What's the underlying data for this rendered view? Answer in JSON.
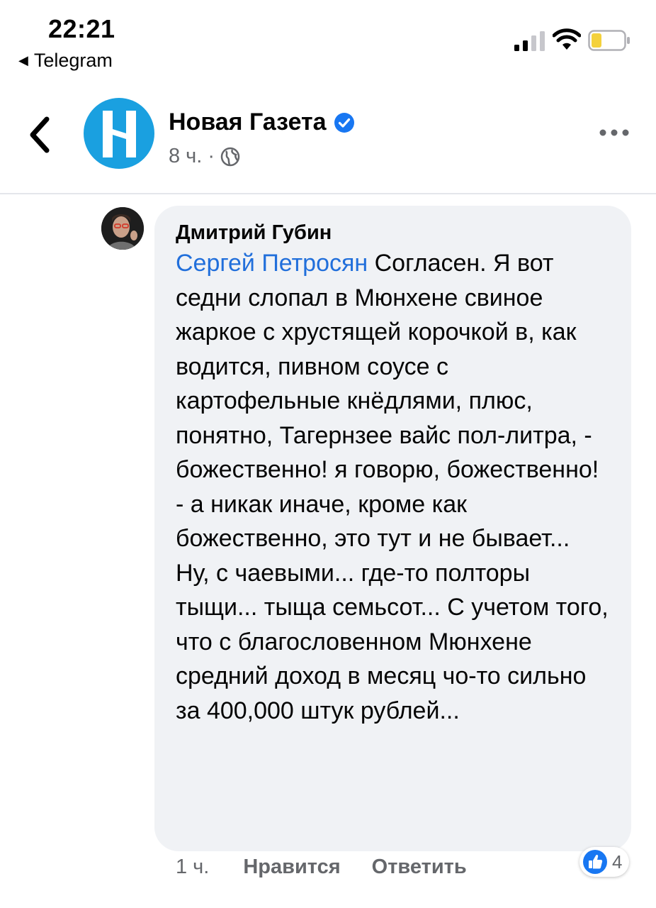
{
  "status_bar": {
    "time": "22:21",
    "back_app": "Telegram",
    "icons": [
      "cellular-signal-icon",
      "wifi-icon",
      "battery-low-icon"
    ],
    "battery_color": "#f4d13c"
  },
  "header": {
    "page_name": "Новая Газета",
    "verified": true,
    "time_ago": "8 ч.",
    "separator": "·",
    "audience_icon": "globe-icon",
    "more_icon": "more-dots-icon",
    "avatar_color": "#1aa0e0"
  },
  "comment": {
    "author": "Дмитрий Губин",
    "mention": "Сергей Петросян",
    "text": " Согласен. Я вот седни слопал в Мюнхене свиное жаркое с хрустящей корочкой в, как водится, пивном соусе с картофельные кнёдлями, плюс, понятно, Тагернзее вайс пол-литра, - божественно! я говорю, божественно! - а никак иначе, кроме как божественно, это тут и не бывает...  Ну, с чаевыми... где-то полторы тыщи... тыща семьсот... С учетом того, что с благословенном Мюнхене средний доход в месяц чо-то сильно за 400,000 штук рублей...",
    "time_ago": "1 ч.",
    "like_label": "Нравится",
    "reply_label": "Ответить",
    "reaction_count": "4",
    "mention_color": "#216fdb",
    "bubble_color": "#f0f2f5"
  }
}
